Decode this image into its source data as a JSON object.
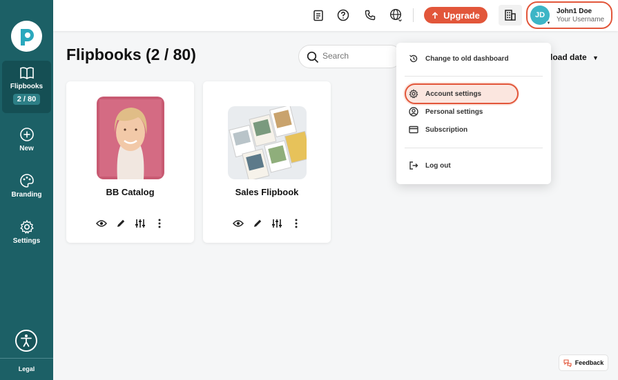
{
  "brand": {
    "accent": "#e2563a",
    "sidebar_bg": "#1c6066"
  },
  "sidebar": {
    "items": [
      {
        "label": "Flipbooks",
        "count": "2 / 80",
        "icon": "book-icon",
        "active": true
      },
      {
        "label": "New",
        "icon": "plus-circle-icon"
      },
      {
        "label": "Branding",
        "icon": "palette-icon"
      },
      {
        "label": "Settings",
        "icon": "gear-icon"
      }
    ],
    "legal": "Legal"
  },
  "header": {
    "upgrade_label": "Upgrade",
    "user": {
      "initials": "JD",
      "name": "John1 Doe",
      "username": "Your Username"
    }
  },
  "main": {
    "title": "Flipbooks (2 / 80)",
    "search_placeholder": "Search",
    "sort_label": "load date",
    "cards": [
      {
        "title": "BB Catalog"
      },
      {
        "title": "Sales Flipbook"
      }
    ]
  },
  "dropdown": {
    "items": [
      {
        "label": "Change to old dashboard",
        "icon": "history-icon"
      },
      {
        "label": "Account settings",
        "icon": "gear-icon"
      },
      {
        "label": "Personal settings",
        "icon": "user-circle-icon"
      },
      {
        "label": "Subscription",
        "icon": "credit-card-icon"
      },
      {
        "label": "Log out",
        "icon": "logout-icon"
      }
    ]
  },
  "feedback_label": "Feedback"
}
